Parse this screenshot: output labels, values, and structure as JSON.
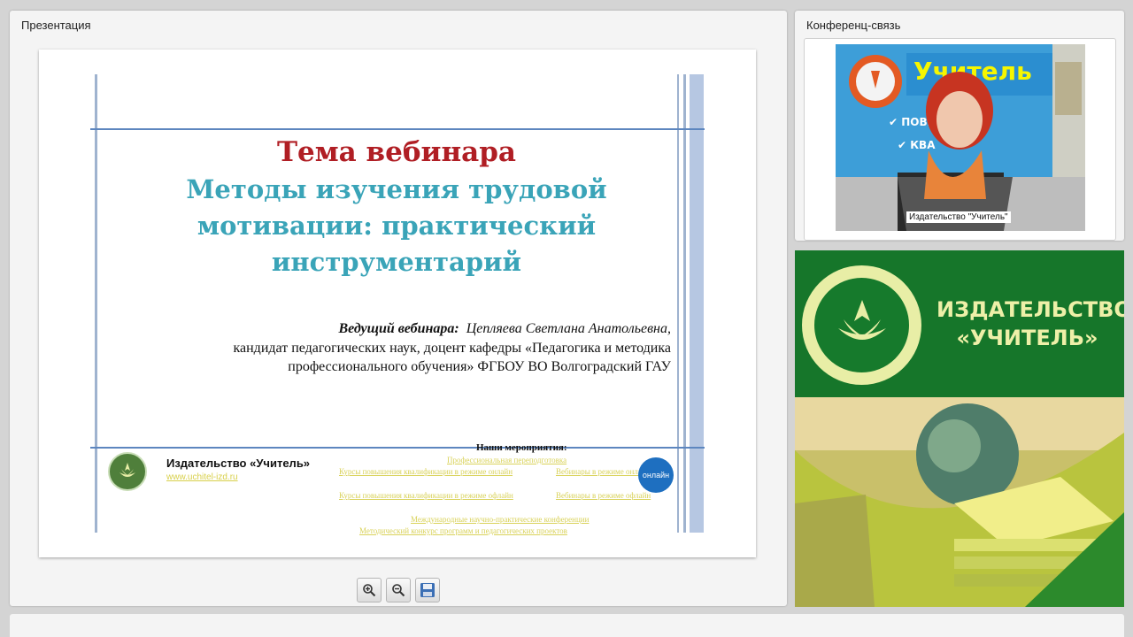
{
  "presentation": {
    "title": "Презентация",
    "slide": {
      "topic_heading": "Тема вебинара",
      "topic_title": "Методы изучения трудовой мотивации: практический инструментарий",
      "host_label": "Ведущий вебинара",
      "host_name": "Цепляева Светлана Анатольевна,",
      "host_details_line1": "кандидат педагогических наук, доцент кафедры «Педагогика и методика",
      "host_details_line2": "профессионального обучения» ФГБОУ ВО Волгоградский ГАУ",
      "publisher_name": "Издательство «Учитель»",
      "publisher_url": "www.uchitel-izd.ru",
      "events_title": "Наши мероприятия:",
      "events": [
        "Профессиональная переподготовка",
        "Курсы повышения квалификации в режиме онлайн",
        "Вебинары в режиме онлайн",
        "Курсы повышения квалификации в режиме офлайн",
        "Вебинары в режиме офлайн",
        "Международные научно-практические конференции",
        "Методический конкурс программ и педагогических проектов"
      ],
      "online_badge": "онлайн"
    },
    "toolbar": {
      "zoom_in": "zoom-in-icon",
      "zoom_out": "zoom-out-icon",
      "save": "save-icon"
    }
  },
  "conference": {
    "title": "Конференц-связь",
    "video_label": "Издательство \"Учитель\""
  },
  "banner": {
    "line1": "ИЗДАТЕЛЬСТВО",
    "line2": "«УЧИТЕЛЬ»"
  },
  "colors": {
    "topic_heading": "#b01e24",
    "topic_title": "#3aa4b8",
    "banner_green": "#16762a",
    "banner_text": "#eef0a8"
  }
}
